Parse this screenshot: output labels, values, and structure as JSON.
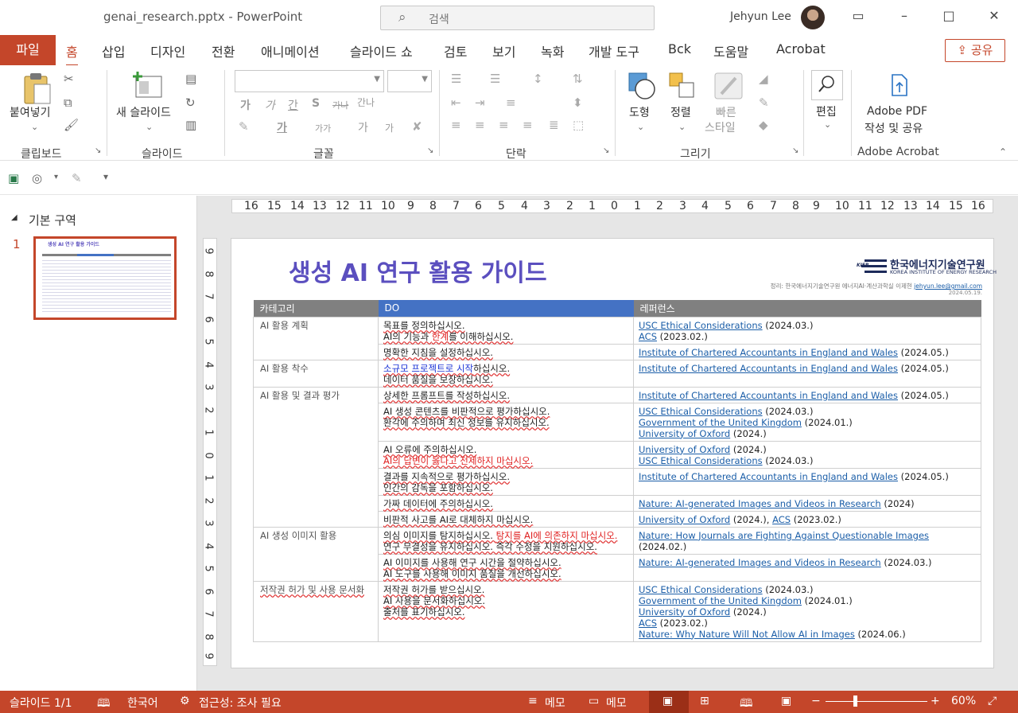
{
  "window": {
    "doc_title": "genai_research.pptx  -  PowerPoint",
    "search_placeholder": "검색",
    "user_name": "Jehyun Lee"
  },
  "tabs": {
    "file": "파일",
    "items": [
      "홈",
      "삽입",
      "디자인",
      "전환",
      "애니메이션",
      "슬라이드 쇼",
      "검토",
      "보기",
      "녹화",
      "개발 도구",
      "Bck",
      "도움말",
      "Acrobat"
    ],
    "active": "홈",
    "share": "공유"
  },
  "ribbon": {
    "paste": "붙여넣기",
    "new_slide": "새 슬라이드",
    "shape": "도형",
    "arrange": "정렬",
    "quick_style_line1": "빠른",
    "quick_style_line2": "스타일",
    "edit": "편집",
    "adobe_line1": "Adobe PDF",
    "adobe_line2": "작성 및 공유",
    "groups": {
      "clipboard": "클립보드",
      "slides": "슬라이드",
      "font": "글꼴",
      "paragraph": "단락",
      "drawing": "그리기",
      "adobe": "Adobe Acrobat"
    },
    "font_buttons": [
      "가",
      "가",
      "간",
      "S",
      "가나",
      "간나"
    ],
    "font_buttons_row2": [
      "가",
      "가가",
      "가",
      "가"
    ]
  },
  "thumbs": {
    "section": "기본 구역",
    "slide_number": "1",
    "thumb_title": "생성 AI 연구 활용 가이드"
  },
  "ruler": {
    "horizontal": [
      "16",
      "15",
      "14",
      "13",
      "12",
      "11",
      "10",
      "9",
      "8",
      "7",
      "6",
      "5",
      "4",
      "3",
      "2",
      "1",
      "0",
      "1",
      "2",
      "3",
      "4",
      "5",
      "6",
      "7",
      "8",
      "9",
      "10",
      "11",
      "12",
      "13",
      "14",
      "15",
      "16"
    ],
    "vertical": [
      "9",
      "8",
      "7",
      "6",
      "5",
      "4",
      "3",
      "2",
      "1",
      "0",
      "1",
      "2",
      "3",
      "4",
      "5",
      "6",
      "7",
      "8",
      "9"
    ]
  },
  "slide": {
    "title": "생성 AI 연구 활용 가이드",
    "logo_ko": "한국에너지기술연구원",
    "logo_en": "KOREA INSTITUTE OF ENERGY RESEARCH",
    "logo_mark": "KIER",
    "author_prefix": "정리: 한국에너지기술연구원 에너지AI·계산과학실 이제현",
    "author_email": "jehyun.lee@gmail.com",
    "date": "2024.05.19.",
    "headers": [
      "카테고리",
      "DO",
      "레퍼런스"
    ],
    "categories": {
      "c1": "AI 활용 계획",
      "c2": "AI 활용 착수",
      "c3": "AI 활용 및 결과 평가",
      "c4": "AI 생성 이미지 활용",
      "c5": "저작권 허가 및 사용 문서화"
    },
    "do": {
      "r1a": "목표를 정의하십시오.",
      "r1b_pre": "AI의 기능과 ",
      "r1b_red": "한계",
      "r1b_post": "를 이해하십시오.",
      "r2": "명확한 지침을 설정하십시오.",
      "r3a_blue": "소규모 프로젝트로 시작",
      "r3a_post": "하십시오.",
      "r3b": "데이터 품질을 보장하십시오.",
      "r4": "상세한 프롬프트를 작성하십시오.",
      "r5a": "AI 생성 콘텐츠를 비판적으로 평가하십시오.",
      "r5b": "환각에 주의하며 최신 정보를 유지하십시오.",
      "r6a": "AI 오류에 주의하십시오.",
      "r6b_red": "AI의 답변이 옳다고 전제하지 마십시오.",
      "r7a": "결과를 지속적으로 평가하십시오.",
      "r7b": "인간의 감독을 포함하십시오.",
      "r8": "가짜 데이터에 주의하십시오.",
      "r9": "비판적 사고를 AI로 대체하지 마십시오.",
      "r10a_pre": "의심 이미지를 탐지하십시오. ",
      "r10a_red": "탐지를 AI에 의존하지 마십시오.",
      "r10b": "연구 무결성을 유지하십시오. 즉각 수정을 지원하십시오.",
      "r11a": "AI 이미지를 사용해 연구 시간을 절약하십시오.",
      "r11b": "AI 도구를 사용해 이미지 품질을 개선하십시오.",
      "r12a": "저작권 허가를 받으십시오.",
      "r12b": "AI 사용을 문서화하십시오.",
      "r12c": "출처를 표기하십시오."
    },
    "refs": {
      "usc": "USC Ethical Considerations",
      "acs": "ACS",
      "icaew": "Institute of Chartered Accountants in England and Wales",
      "gov": "Government of the United Kingdom",
      "oxford": "University of Oxford",
      "nature_ai": "Nature: AI-generated Images and Videos in Research",
      "nature_journals": "Nature: How Journals are Fighting Against Questionable Images",
      "nature_why": "Nature: Why Nature Will Not Allow AI in Images",
      "d_2024_03": " (2024.03.)",
      "d_2023_02": " (2023.02.)",
      "d_2024_05": " (2024.05.)",
      "d_2024_01": " (2024.01.)",
      "d_2024": " (2024.)",
      "d_2024_plain": " (2024)",
      "d_2024_comma": " (2024.), ",
      "d_2024_02": " (2024.02.)",
      "d_2024_06": " (2024.06.)"
    }
  },
  "status": {
    "slide_count": "슬라이드 1/1",
    "language": "한국어",
    "accessibility": "접근성: 조사 필요",
    "notes": "메모",
    "comments": "메모",
    "zoom": "60%"
  }
}
